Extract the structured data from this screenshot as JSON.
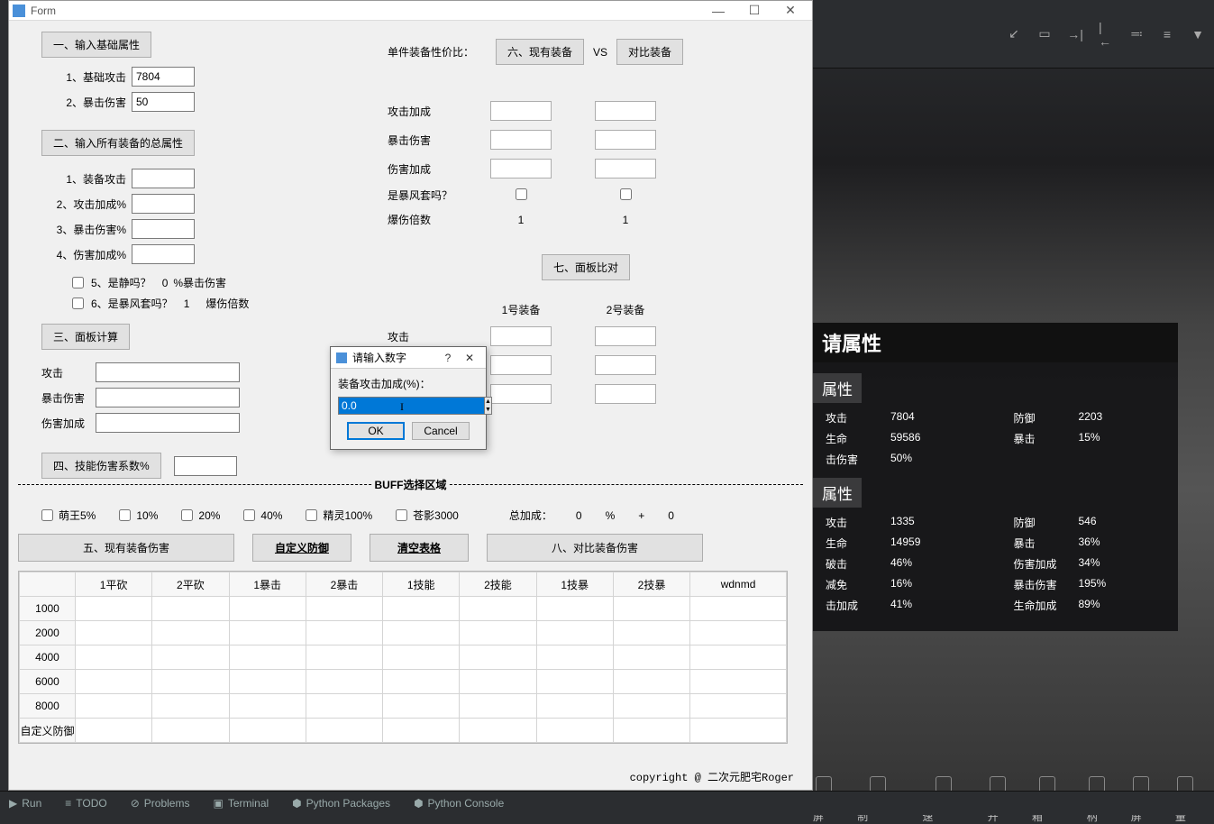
{
  "window": {
    "title": "Form"
  },
  "section1": {
    "title": "一、输入基础属性",
    "base_attack_lbl": "1、基础攻击",
    "base_attack_val": "7804",
    "crit_dmg_lbl": "2、暴击伤害",
    "crit_dmg_val": "50"
  },
  "section2": {
    "title": "二、输入所有装备的总属性",
    "r1": "1、装备攻击",
    "r2": "2、攻击加成%",
    "r3": "3、暴击伤害%",
    "r4": "4、伤害加成%",
    "r5": "5、是静吗？",
    "r5_val": "0",
    "r5_suffix": "%暴击伤害",
    "r6": "6、是暴风套吗？",
    "r6_val": "1",
    "r6_suffix": "爆伤倍数"
  },
  "equip_cmp": {
    "title": "单件装备性价比：",
    "btn1": "六、现有装备",
    "vs": "VS",
    "btn2": "对比装备",
    "atk_bonus": "攻击加成",
    "crit_dmg": "暴击伤害",
    "dmg_bonus": "伤害加成",
    "is_storm": "是暴风套吗？",
    "crit_mult": "爆伤倍数",
    "m1": "1",
    "m2": "1"
  },
  "section3": {
    "title": "三、面板计算",
    "atk": "攻击",
    "crit": "暴击伤害",
    "dmg": "伤害加成"
  },
  "section4": {
    "title": "四、技能伤害系数%"
  },
  "panel7": {
    "title": "七、面板比对",
    "e1": "1号装备",
    "e2": "2号装备",
    "atk": "攻击"
  },
  "buff": {
    "title": "BUFF选择区域",
    "b1": "萌王5%",
    "b2": "10%",
    "b3": "20%",
    "b4": "40%",
    "b5": "精灵100%",
    "b6": "苍影3000",
    "sum_lbl": "总加成：",
    "sum_v1": "0",
    "sum_pct": "%",
    "sum_plus": "+",
    "sum_v2": "0"
  },
  "actions": {
    "btn5": "五、现有装备伤害",
    "custom_def": "自定义防御",
    "clear": "清空表格",
    "btn8": "八、对比装备伤害"
  },
  "grid": {
    "cols": [
      "1平砍",
      "2平砍",
      "1暴击",
      "2暴击",
      "1技能",
      "2技能",
      "1技暴",
      "2技暴",
      "wdnmd"
    ],
    "rows": [
      "1000",
      "2000",
      "4000",
      "6000",
      "8000",
      "自定义防御"
    ]
  },
  "copyright": "copyright @ 二次元肥宅Roger",
  "modal": {
    "title": "请输入数字",
    "label": "装备攻击加成(%)：",
    "value": "0.0",
    "ok": "OK",
    "cancel": "Cancel"
  },
  "game": {
    "panel_title": "请属性",
    "sub1": "属性",
    "s1": [
      {
        "k": "攻击",
        "v": "7804"
      },
      {
        "k": "防御",
        "v": "2203"
      },
      {
        "k": "生命",
        "v": "59586"
      },
      {
        "k": "暴击",
        "v": "15%"
      },
      {
        "k": "击伤害",
        "v": "50%"
      },
      {
        "k": "",
        "v": ""
      }
    ],
    "sub2": "属性",
    "s2": [
      {
        "k": "攻击",
        "v": "1335"
      },
      {
        "k": "防御",
        "v": "546"
      },
      {
        "k": "生命",
        "v": "14959"
      },
      {
        "k": "暴击",
        "v": "36%"
      },
      {
        "k": "破击",
        "v": "46%"
      },
      {
        "k": "伤害加成",
        "v": "34%"
      },
      {
        "k": "减免",
        "v": "16%"
      },
      {
        "k": "暴击伤害",
        "v": "195%"
      },
      {
        "k": "击加成",
        "v": "41%"
      },
      {
        "k": "生命加成",
        "v": "89%"
      }
    ]
  },
  "ide": {
    "run": "Run",
    "todo": "TODO",
    "problems": "Problems",
    "terminal": "Terminal",
    "pypkg": "Python Packages",
    "pycon": "Python Console"
  },
  "dock": {
    "items": [
      "录屏",
      "操作录制",
      "外挂加速",
      "多开",
      "工具箱",
      "手柄",
      "全屏",
      "音量"
    ]
  }
}
